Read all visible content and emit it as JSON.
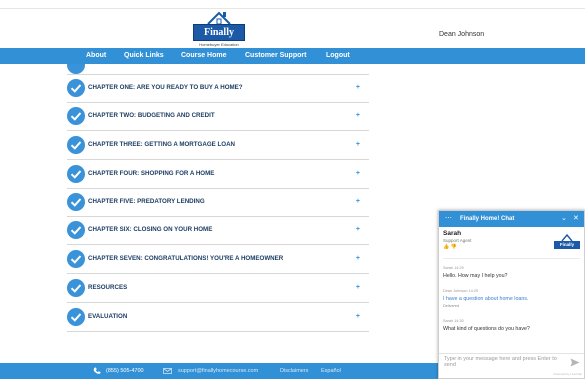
{
  "header": {
    "logo_text": "Finally Home!",
    "logo_tagline": "Homebuyer Education",
    "user_name": "Dean Johnson"
  },
  "nav": {
    "items": [
      "About",
      "Quick Links",
      "Course Home",
      "Customer Support",
      "Logout"
    ]
  },
  "chapters": [
    {
      "title": "CHAPTER ONE: ARE YOU READY TO BUY A HOME?",
      "expand": "+"
    },
    {
      "title": "CHAPTER TWO: BUDGETING AND CREDIT",
      "expand": "+"
    },
    {
      "title": "CHAPTER THREE: GETTING A MORTGAGE LOAN",
      "expand": "+"
    },
    {
      "title": "CHAPTER FOUR: SHOPPING FOR A HOME",
      "expand": "+"
    },
    {
      "title": "CHAPTER FIVE: PREDATORY LENDING",
      "expand": "+"
    },
    {
      "title": "CHAPTER SIX: CLOSING ON YOUR HOME",
      "expand": "+"
    },
    {
      "title": "CHAPTER SEVEN: CONGRATULATIONS! YOU'RE A HOMEOWNER",
      "expand": "+"
    },
    {
      "title": "RESOURCES",
      "expand": "+"
    },
    {
      "title": "EVALUATION",
      "expand": "+"
    }
  ],
  "footer": {
    "phone": "(855) 505-4700",
    "email": "support@finallyhomecourse.com",
    "disclaimers": "Disclaimers",
    "espanol": "Español"
  },
  "chat": {
    "title": "Finally Home! Chat",
    "agent_name": "Sarah",
    "agent_role": "Support Agent",
    "messages": [
      {
        "meta": "Sarah 14:29",
        "text": "Hello. How may I help you?",
        "from": "agent"
      },
      {
        "meta": "Dean Johnson 14:29",
        "text": "I have a question about home loans.",
        "status": "Delivered",
        "from": "user"
      },
      {
        "meta": "Sarah 14:30",
        "text": "What kind of questions do you have?",
        "from": "agent"
      }
    ],
    "input_placeholder": "Type in your message here and press Enter to send",
    "powered_by": "Powered by LiveChat"
  },
  "colors": {
    "nav_blue": "#3291d6",
    "brand_blue": "#1c5aa8",
    "heading_navy": "#1d3d63"
  },
  "icons": [
    "check-circle-icon",
    "plus-icon",
    "phone-icon",
    "email-icon",
    "send-icon",
    "minimize-icon",
    "close-icon",
    "menu-dots-icon"
  ]
}
